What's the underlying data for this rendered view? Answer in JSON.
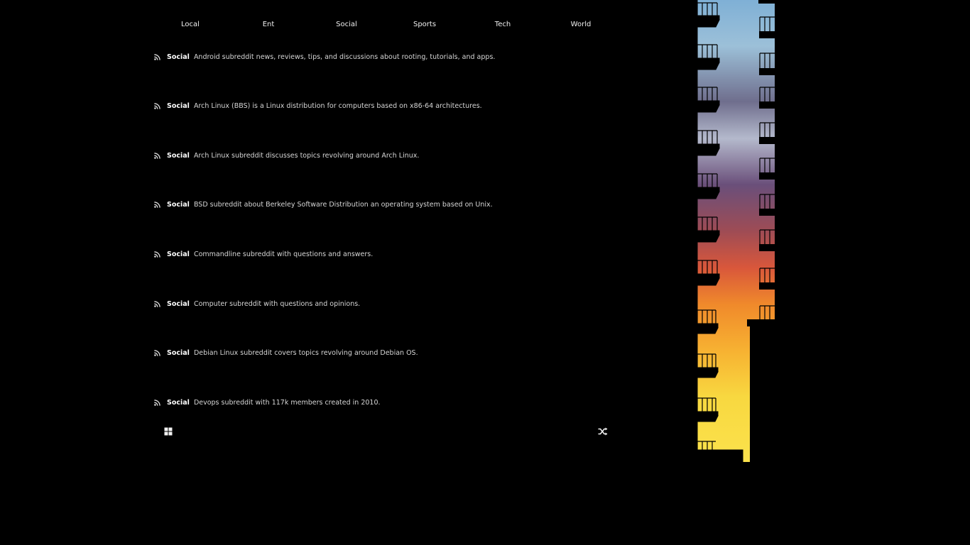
{
  "nav": {
    "tabs": [
      "Local",
      "Ent",
      "Social",
      "Sports",
      "Tech",
      "World"
    ]
  },
  "feed": {
    "items": [
      {
        "category": "Social",
        "text": "Android subreddit news, reviews, tips, and discussions about rooting, tutorials, and apps."
      },
      {
        "category": "Social",
        "text": "Arch Linux (BBS) is a Linux distribution for computers based on x86-64 architectures."
      },
      {
        "category": "Social",
        "text": "Arch Linux subreddit discusses topics revolving around Arch Linux."
      },
      {
        "category": "Social",
        "text": "BSD subreddit about Berkeley Software Distribution an operating system based on Unix."
      },
      {
        "category": "Social",
        "text": "Commandline subreddit with questions and answers."
      },
      {
        "category": "Social",
        "text": "Computer subreddit with questions and opinions."
      },
      {
        "category": "Social",
        "text": "Debian Linux subreddit covers topics revolving around Debian OS."
      },
      {
        "category": "Social",
        "text": "Devops subreddit with 117k members created in 2010."
      }
    ]
  },
  "icons": {
    "feed_item": "rss-icon",
    "bottom_left": "grid-icon",
    "bottom_right": "shuffle-icon"
  },
  "colors": {
    "background": "#000000",
    "text": "#e8e8e8"
  }
}
